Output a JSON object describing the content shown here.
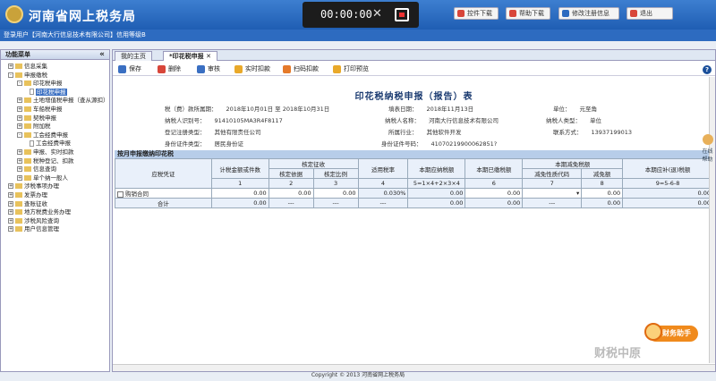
{
  "header": {
    "title": "河南省网上税务局",
    "recorder_time": "00:00:00",
    "buttons": [
      "控件下载",
      "帮助下载",
      "修改注册信息",
      "退出"
    ]
  },
  "subbar": {
    "login_text": "登录用户【河南大行信息技术有限公司】信用等级B"
  },
  "sidebar": {
    "title": "功能菜单",
    "collapse": "«",
    "items": [
      {
        "label": "信息采集",
        "type": "folder",
        "pm": "+"
      },
      {
        "label": "申报缴税",
        "type": "folder",
        "pm": "-"
      },
      {
        "label": "印花税申报",
        "type": "folder",
        "pm": "-"
      },
      {
        "label": "印花税申报",
        "type": "doc",
        "selected": true
      },
      {
        "label": "土地增值税申报（查从源扣）",
        "type": "folder",
        "pm": "+"
      },
      {
        "label": "车船税申报",
        "type": "folder",
        "pm": "+"
      },
      {
        "label": "契税申报",
        "type": "folder",
        "pm": "+"
      },
      {
        "label": "附加税",
        "type": "folder",
        "pm": "+"
      },
      {
        "label": "工会经费申报",
        "type": "folder",
        "pm": "-"
      },
      {
        "label": "工会经费申报",
        "type": "doc"
      },
      {
        "label": "申报、实时扣款",
        "type": "folder",
        "pm": "+"
      },
      {
        "label": "税种登记、扣款",
        "type": "folder",
        "pm": "+"
      },
      {
        "label": "信息查询",
        "type": "folder",
        "pm": "+"
      },
      {
        "label": "单个纳一般人",
        "type": "folder",
        "pm": "+"
      },
      {
        "label": "涉税事项办理",
        "type": "folder",
        "pm": "+"
      },
      {
        "label": "发票办理",
        "type": "folder",
        "pm": "+"
      },
      {
        "label": "查账征收",
        "type": "folder",
        "pm": "+"
      },
      {
        "label": "地方税费业务办理",
        "type": "folder",
        "pm": "+"
      },
      {
        "label": "涉税风险查询",
        "type": "folder",
        "pm": "+"
      },
      {
        "label": "用户信息管理",
        "type": "folder",
        "pm": "+"
      }
    ]
  },
  "tabs": [
    "我的主页",
    "*印花税申报"
  ],
  "toolbar": {
    "buttons": [
      "保存",
      "删除",
      "审核",
      "实时扣款",
      "扫码扣款",
      "打印预览"
    ]
  },
  "form": {
    "title": "印花税纳税申报（报告）表",
    "info_rows": [
      [
        "税（费）款所属期：",
        "2018年10月01日 至 2018年10月31日",
        "填表日期：",
        "2018年11月13日",
        "单位：",
        "元至角"
      ],
      [
        "纳税人识别号：",
        "91410105MA3R4F8117",
        "纳税人名称：",
        "河南大行信息技术有限公司",
        "纳税人类型：",
        "单位"
      ],
      [
        "登记注册类型：",
        "其他有限责任公司",
        "所属行业：",
        "其他软件开发",
        "联系方式：",
        "13937199013"
      ],
      [
        "身份证件类型：",
        "居民身份证",
        "身份证件号码：",
        "41070219900062851?",
        "",
        ""
      ]
    ]
  },
  "table": {
    "section_title": "按月申报缴纳印花税",
    "headers": {
      "col1": "应税凭证",
      "col2": "计税金额或件数",
      "col3": "核定征收",
      "col3a": "核定依据",
      "col3b": "核定比例",
      "col4": "适用税率",
      "col5": "本期应纳税额",
      "col6": "本期已缴税额",
      "col7": "本期减免税额",
      "col7a": "减免性质代码",
      "col7b": "减免额",
      "col8": "本期应补(退)税额"
    },
    "numbers": [
      "1",
      "2",
      "3",
      "4",
      "5=1×4+2×3×4",
      "6",
      "7",
      "8",
      "9=5-6-8"
    ],
    "rows": [
      {
        "label": "购销合同",
        "c1": "0.00",
        "c2": "0.00",
        "c3": "0.00",
        "c4": "0.030%",
        "c5": "0.00",
        "c6": "0.00",
        "c7": "",
        "c8": "0.00",
        "c9": "0.00"
      },
      {
        "label": "合计",
        "c1": "0.00",
        "c2": "---",
        "c3": "---",
        "c4": "---",
        "c5": "0.00",
        "c6": "0.00",
        "c7": "---",
        "c8": "0.00",
        "c9": "0.00"
      }
    ]
  },
  "footer": "Copyright © 2013 河南省网上税务局",
  "badge": "财务助手",
  "watermark": "财税中原",
  "right_side": "在线帮助"
}
